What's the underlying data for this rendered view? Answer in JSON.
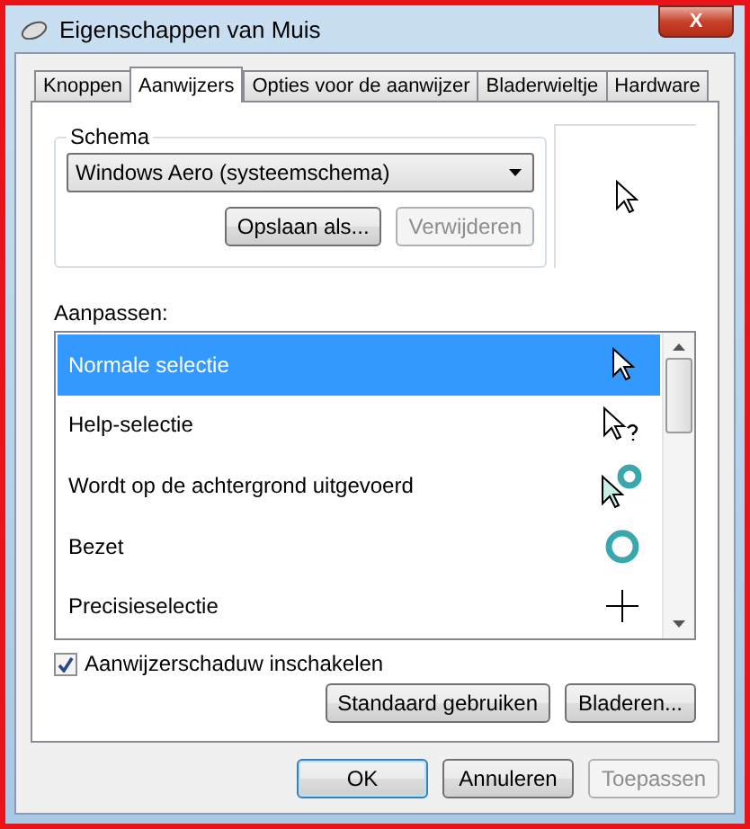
{
  "window": {
    "title": "Eigenschappen van Muis",
    "close": "X"
  },
  "tabs": [
    {
      "label": "Knoppen",
      "selected": false
    },
    {
      "label": "Aanwijzers",
      "selected": true
    },
    {
      "label": "Opties voor de aanwijzer",
      "selected": false
    },
    {
      "label": "Bladerwieltje",
      "selected": false
    },
    {
      "label": "Hardware",
      "selected": false
    }
  ],
  "schema": {
    "legend": "Schema",
    "dropdown": "Windows Aero (systeemschema)",
    "buttons": [
      {
        "label": "Opslaan als...",
        "disabled": false
      },
      {
        "label": "Verwijderen",
        "disabled": true
      }
    ]
  },
  "customize": {
    "label": "Aanpassen:",
    "rows": [
      {
        "label": "Normale selectie",
        "kind": "arrow",
        "selected": true
      },
      {
        "label": "Help-selectie",
        "kind": "help",
        "selected": false
      },
      {
        "label": "Wordt op de achtergrond uitgevoerd",
        "kind": "working",
        "selected": false
      },
      {
        "label": "Bezet",
        "kind": "busy",
        "selected": false
      },
      {
        "label": "Precisieselectie",
        "kind": "cross",
        "selected": false
      }
    ]
  },
  "shadow": {
    "label": "Aanwijzerschaduw inschakelen",
    "checked": true
  },
  "panel_buttons": [
    {
      "label": "Standaard gebruiken",
      "disabled": false
    },
    {
      "label": "Bladeren...",
      "disabled": false
    }
  ],
  "dialog_buttons": [
    {
      "label": "OK",
      "disabled": false,
      "default": true
    },
    {
      "label": "Annuleren",
      "disabled": false,
      "default": false
    },
    {
      "label": "Toepassen",
      "disabled": true,
      "default": false
    }
  ]
}
